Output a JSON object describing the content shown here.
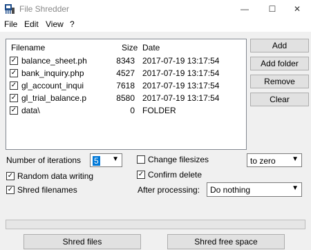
{
  "window": {
    "title": "File Shredder",
    "min_glyph": "—",
    "max_glyph": "☐",
    "close_glyph": "✕"
  },
  "menu": [
    "File",
    "Edit",
    "View",
    "?"
  ],
  "list": {
    "columns": [
      "Filename",
      "Size",
      "Date"
    ],
    "rows": [
      {
        "name": "balance_sheet.ph",
        "size": "8343",
        "date": "2017-07-19 13:17:54",
        "checked": true
      },
      {
        "name": "bank_inquiry.php",
        "size": "4527",
        "date": "2017-07-19 13:17:54",
        "checked": true
      },
      {
        "name": "gl_account_inqui",
        "size": "7618",
        "date": "2017-07-19 13:17:54",
        "checked": true
      },
      {
        "name": "gl_trial_balance.p",
        "size": "8580",
        "date": "2017-07-19 13:17:54",
        "checked": true
      },
      {
        "name": "data\\",
        "size": "0",
        "date": "FOLDER",
        "checked": true
      }
    ]
  },
  "side_buttons": {
    "add": "Add",
    "add_folder": "Add folder",
    "remove": "Remove",
    "clear": "Clear"
  },
  "options": {
    "iterations_label": "Number of iterations",
    "iterations_value": "5",
    "change_filesizes": {
      "label": "Change filesizes",
      "checked": false
    },
    "filesize_mode": "to zero",
    "random_data": {
      "label": "Random data writing",
      "checked": true
    },
    "confirm_delete": {
      "label": "Confirm delete",
      "checked": true
    },
    "shred_filenames": {
      "label": "Shred filenames",
      "checked": true
    },
    "after_processing_label": "After processing:",
    "after_processing_value": "Do nothing"
  },
  "progress": {
    "value": 0
  },
  "bottom_buttons": {
    "shred_files": "Shred files",
    "shred_free_space": "Shred free space"
  },
  "check_glyph": "✓",
  "icons": {
    "app": "shredder-app-icon",
    "arrow": "chevron-down-icon"
  }
}
